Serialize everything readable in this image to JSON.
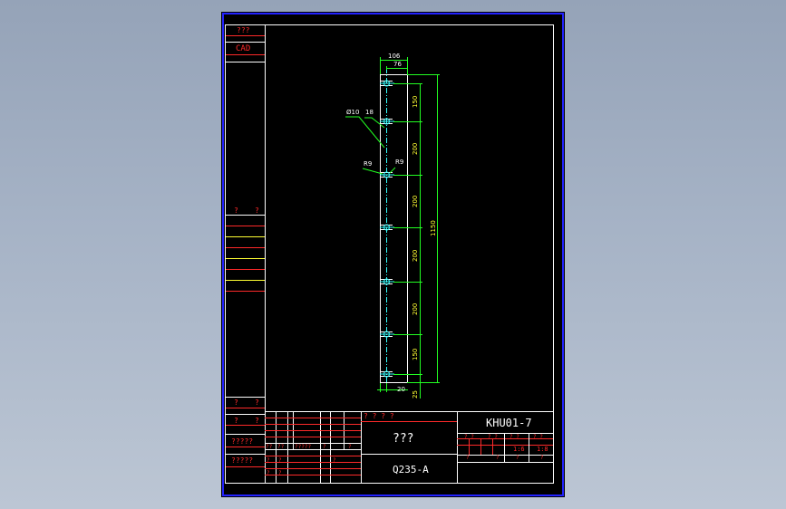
{
  "left_strip": {
    "top_label_1": "???",
    "top_label_2": "CAD",
    "mid_label_a": "?",
    "mid_label_b": "?",
    "bottom_rows": [
      {
        "a": "?",
        "b": "?"
      },
      {
        "a": "?",
        "b": "?"
      },
      {
        "a": "?????",
        "b": ""
      },
      {
        "a": "?????",
        "b": ""
      }
    ]
  },
  "part": {
    "dimensions": {
      "width_total": "106",
      "width_inner": "76",
      "hole_dia": "Ø10",
      "slot": "18",
      "radius_left": "R9",
      "radius_right": "R9",
      "spacings": [
        "150",
        "200",
        "200",
        "200",
        "200",
        "150"
      ],
      "overall_length": "1150",
      "bottom_offset": "20",
      "bottom_edge": "25"
    }
  },
  "title_block": {
    "top_marks": "? ? ? ?",
    "name": "???",
    "material": "Q235-A",
    "drawing_number": "KHU01-7",
    "scale_row": [
      "? ?",
      "? ?",
      "? ?",
      "? ?"
    ],
    "mass_value": "1:6",
    "scale_value": "1:8",
    "misc_cells": [
      "?",
      "?",
      "?",
      "?"
    ],
    "left_grid": {
      "row1": [
        "??",
        "??",
        "?????",
        "?",
        "?"
      ],
      "row2": [
        "?",
        "?",
        "?"
      ],
      "row3": [
        "?",
        "?"
      ]
    }
  },
  "colors": {
    "frame_blue": "#2222ff",
    "line_white": "#ffffff",
    "line_red": "#ff2a2a",
    "line_yellow": "#ffff33",
    "line_green": "#22ff22",
    "line_cyan": "#33ffff",
    "background": "#000000"
  }
}
